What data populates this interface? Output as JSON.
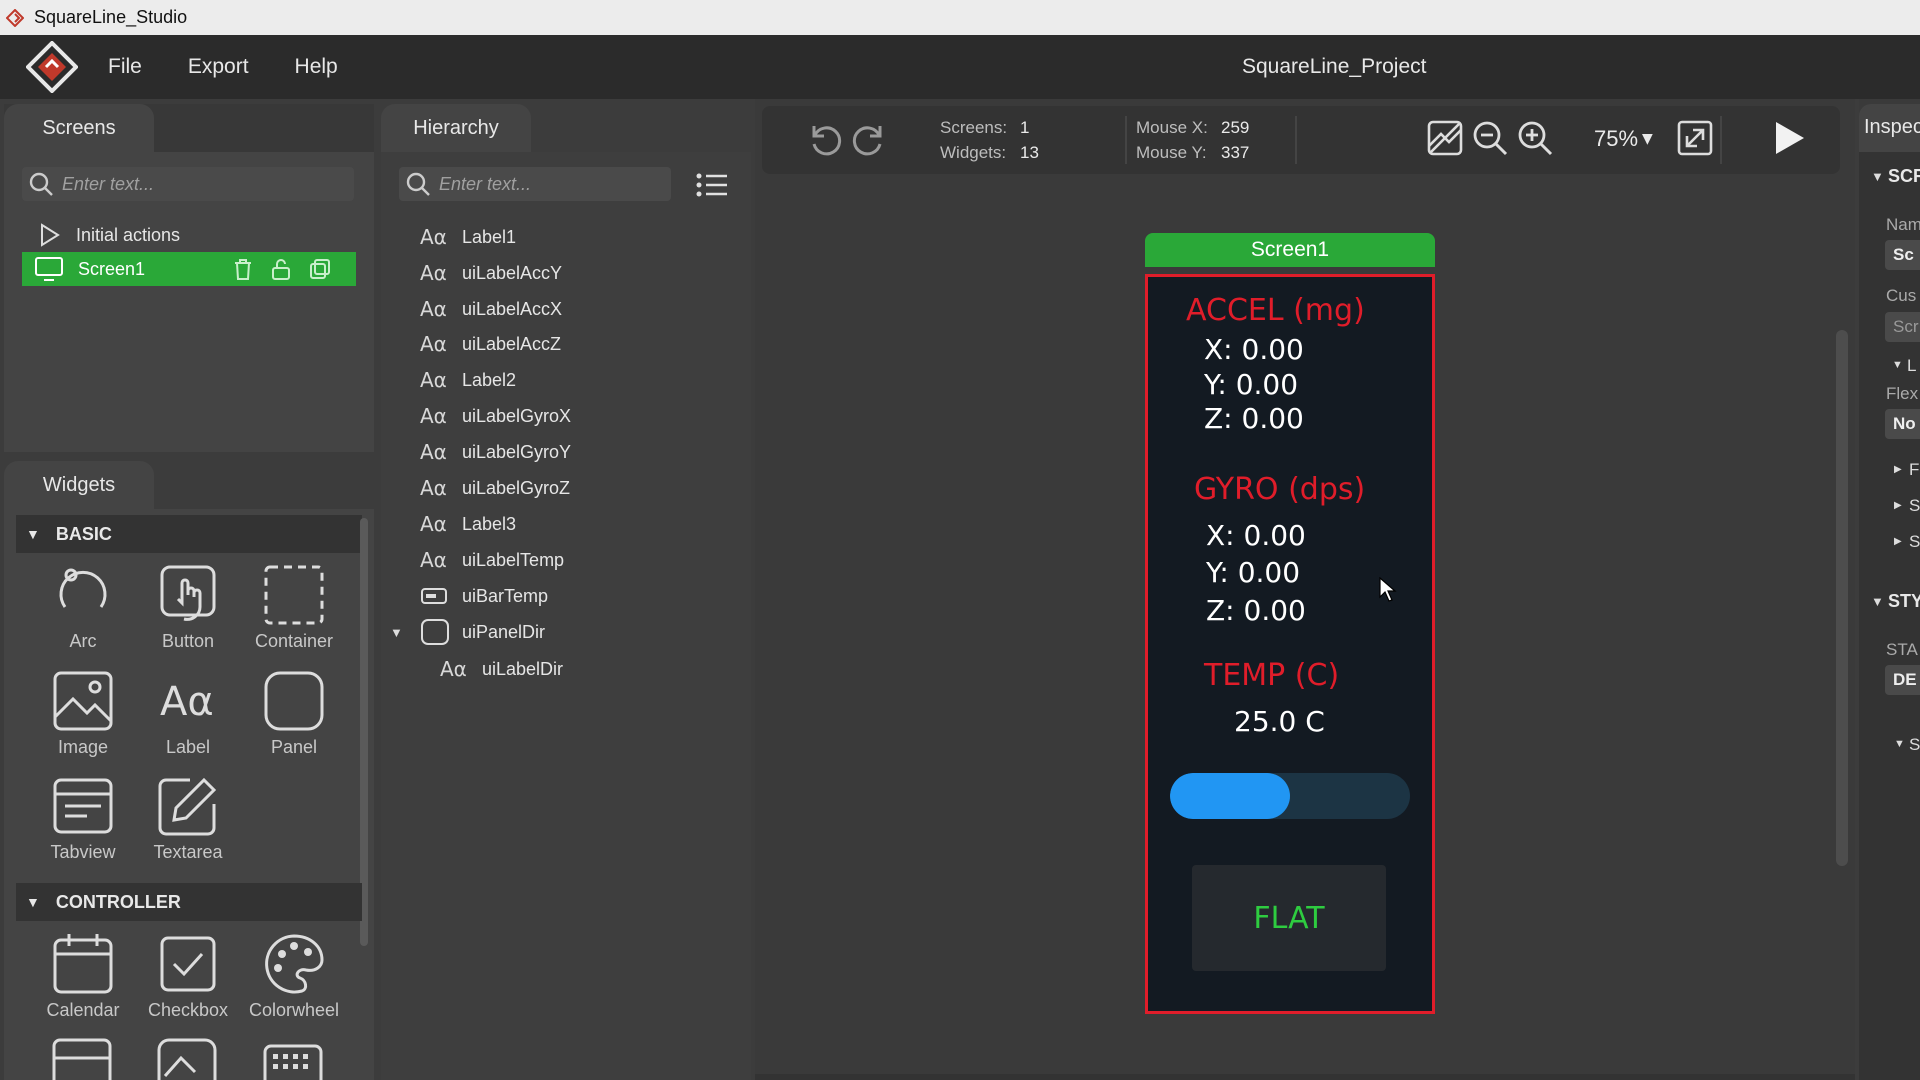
{
  "window": {
    "title": "SquareLine_Studio"
  },
  "menu": {
    "file": "File",
    "export": "Export",
    "help": "Help"
  },
  "project": {
    "title": "SquareLine_Project"
  },
  "screens_panel": {
    "tab": "Screens",
    "search_placeholder": "Enter text...",
    "initial_actions": "Initial actions",
    "screen_item": "Screen1"
  },
  "widgets_panel": {
    "tab": "Widgets",
    "basic_header": "BASIC",
    "controller_header": "CONTROLLER",
    "basic": [
      "Arc",
      "Button",
      "Container",
      "Image",
      "Label",
      "Panel",
      "Tabview",
      "Textarea"
    ],
    "controller": [
      "Calendar",
      "Checkbox",
      "Colorwheel"
    ]
  },
  "hierarchy": {
    "tab": "Hierarchy",
    "search_placeholder": "Enter text...",
    "aa_glyph": "Aα",
    "items": [
      {
        "label": "Label1",
        "icon": "label-icon"
      },
      {
        "label": "uiLabelAccY",
        "icon": "label-icon"
      },
      {
        "label": "uiLabelAccX",
        "icon": "label-icon"
      },
      {
        "label": "uiLabelAccZ",
        "icon": "label-icon"
      },
      {
        "label": "Label2",
        "icon": "label-icon"
      },
      {
        "label": "uiLabelGyroX",
        "icon": "label-icon"
      },
      {
        "label": "uiLabelGyroY",
        "icon": "label-icon"
      },
      {
        "label": "uiLabelGyroZ",
        "icon": "label-icon"
      },
      {
        "label": "Label3",
        "icon": "label-icon"
      },
      {
        "label": "uiLabelTemp",
        "icon": "label-icon"
      },
      {
        "label": "uiBarTemp",
        "icon": "bar-icon"
      },
      {
        "label": "uiPanelDir",
        "icon": "panel-icon"
      },
      {
        "label": "uiLabelDir",
        "icon": "label-icon"
      }
    ]
  },
  "toolbar": {
    "screens_label": "Screens:",
    "screens_value": "1",
    "widgets_label": "Widgets:",
    "widgets_value": "13",
    "mouse_x_label": "Mouse X:",
    "mouse_x_value": "259",
    "mouse_y_label": "Mouse Y:",
    "mouse_y_value": "337",
    "zoom": "75%"
  },
  "device": {
    "screen_tab": "Screen1",
    "accel_title": "ACCEL (mg)",
    "accel_x": "X: 0.00",
    "accel_y": "Y: 0.00",
    "accel_z": "Z: 0.00",
    "gyro_title": "GYRO (dps)",
    "gyro_x": "X: 0.00",
    "gyro_y": "Y: 0.00",
    "gyro_z": "Z: 0.00",
    "temp_title": "TEMP (C)",
    "temp_value": "25.0 C",
    "temp_bar_fraction": 0.5,
    "dir_label": "FLAT"
  },
  "inspector": {
    "tab": "Inspec",
    "screen_section": "SCR",
    "name_label": "Nam",
    "name_value": "Sc",
    "custom_label": "Cus",
    "custom_value": "Scr",
    "layout_label": "L",
    "flex_label": "Flex",
    "flex_value": "No",
    "f_label": "F",
    "s1_label": "S",
    "s2_label": "S",
    "style_section": "STYI",
    "state_label": "STA",
    "state_value": "DE",
    "s3_label": "S"
  },
  "colors": {
    "accent_green": "#2aa838",
    "device_border": "#e01d2a",
    "bar_blue": "#2196f3",
    "flat_green": "#2ecc40"
  }
}
